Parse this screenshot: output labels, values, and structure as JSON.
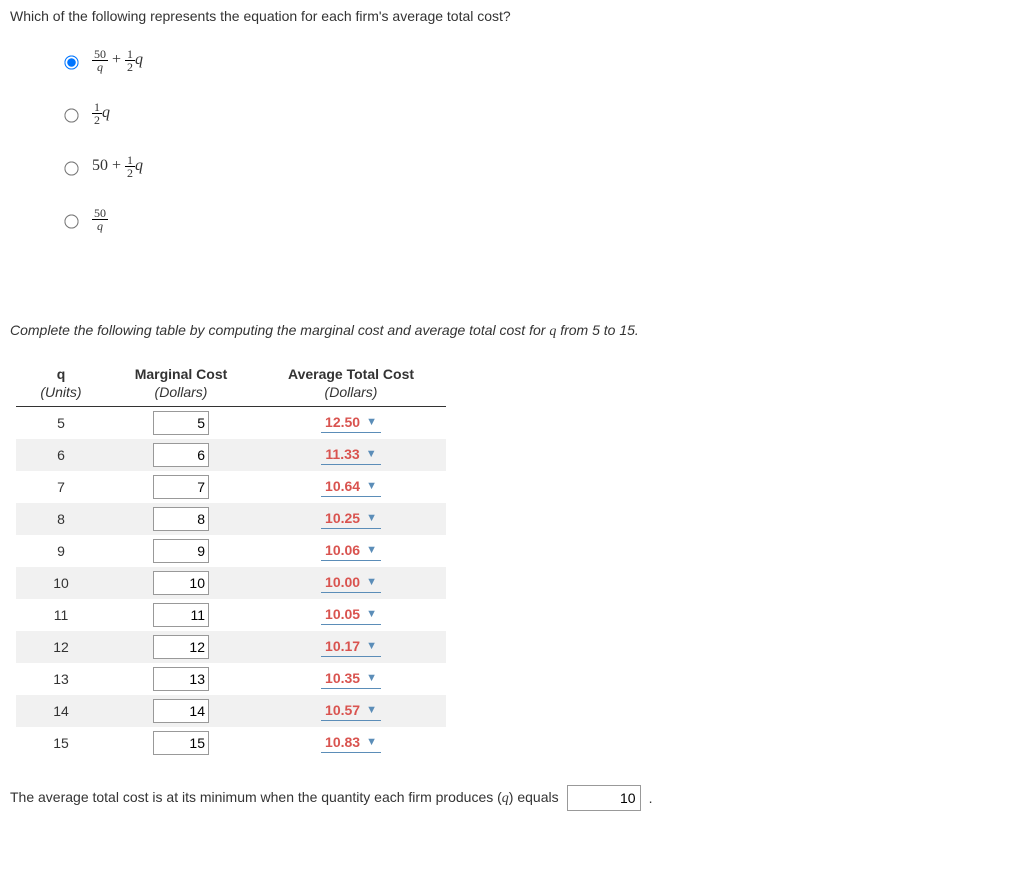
{
  "question": "Which of the following represents the equation for each firm's average total cost?",
  "options": {
    "a_num1": "50",
    "a_den1": "q",
    "a_plus": " + ",
    "a_num2": "1",
    "a_den2": "2",
    "a_tail": "q",
    "b_num": "1",
    "b_den": "2",
    "b_tail": "q",
    "c_lead": "50 + ",
    "c_num": "1",
    "c_den": "2",
    "c_tail": "q",
    "d_num": "50",
    "d_den": "q"
  },
  "instruction_pre": "Complete the following table by computing the marginal cost and average total cost for ",
  "instruction_var": "q",
  "instruction_post": " from 5 to 15.",
  "headers": {
    "q": "q",
    "mc": "Marginal Cost",
    "atc": "Average Total Cost",
    "q_unit": "(Units)",
    "mc_unit": "(Dollars)",
    "atc_unit": "(Dollars)"
  },
  "rows": [
    {
      "q": "5",
      "mc": "5",
      "atc": "12.50"
    },
    {
      "q": "6",
      "mc": "6",
      "atc": "11.33"
    },
    {
      "q": "7",
      "mc": "7",
      "atc": "10.64"
    },
    {
      "q": "8",
      "mc": "8",
      "atc": "10.25"
    },
    {
      "q": "9",
      "mc": "9",
      "atc": "10.06"
    },
    {
      "q": "10",
      "mc": "10",
      "atc": "10.00"
    },
    {
      "q": "11",
      "mc": "11",
      "atc": "10.05"
    },
    {
      "q": "12",
      "mc": "12",
      "atc": "10.17"
    },
    {
      "q": "13",
      "mc": "13",
      "atc": "10.35"
    },
    {
      "q": "14",
      "mc": "14",
      "atc": "10.57"
    },
    {
      "q": "15",
      "mc": "15",
      "atc": "10.83"
    }
  ],
  "final_pre": "The average total cost is at its minimum when the quantity each firm produces (",
  "final_var": "q",
  "final_mid": ") equals",
  "final_value": "10",
  "final_end": "."
}
